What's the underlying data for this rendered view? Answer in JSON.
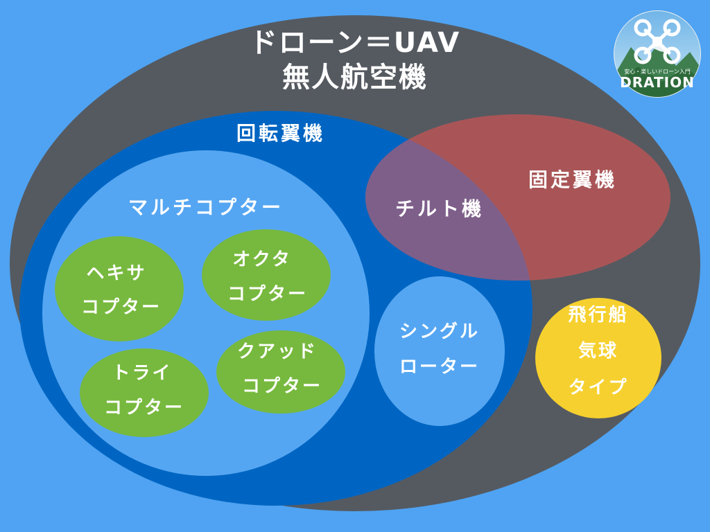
{
  "title": {
    "line1": "ドローン＝UAV",
    "line2": "無人航空機"
  },
  "groups": {
    "rotary_wing": "回転翼機",
    "fixed_wing": "固定翼機",
    "tilt": "チルト機",
    "multicopter": "マルチコプター",
    "hexa": [
      "ヘキサ",
      "コプター"
    ],
    "octa": [
      "オクタ",
      "コプター"
    ],
    "tri": [
      "トライ",
      "コプター"
    ],
    "quad": [
      "クアッド",
      "コプター"
    ],
    "single": [
      "シングル",
      "ローター"
    ],
    "airship": [
      "飛行船",
      "気球",
      "タイプ"
    ]
  },
  "logo": {
    "tagline": "安心・楽しいドローン入門",
    "name": "DRATION"
  },
  "colors": {
    "background": "#4fa3f2",
    "uav": "#555a61",
    "rotary": "#0065c2",
    "multicopter": "#55a6f2",
    "green": "#77b93e",
    "fixed_wing": "#a95557",
    "tilt": "#7e5f8a",
    "airship": "#f6d02e"
  },
  "icons": {
    "logo": "drone-icon"
  }
}
